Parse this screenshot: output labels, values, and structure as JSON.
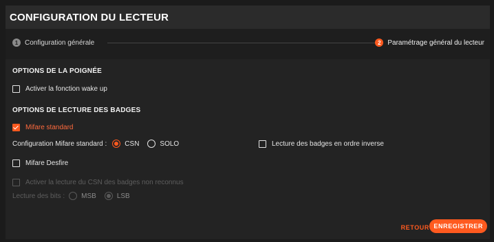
{
  "window": {
    "title": "CONFIGURATION DU LECTEUR"
  },
  "stepper": {
    "steps": [
      {
        "number": "1",
        "label": "Configuration générale"
      },
      {
        "number": "2",
        "label": "Paramétrage général du lecteur"
      }
    ],
    "active_step": 2
  },
  "handle_options": {
    "title": "OPTIONS DE LA POIGNÉE",
    "wake_up_label": "Activer la fonction wake up",
    "wake_up_checked": false
  },
  "badge_options": {
    "title": "OPTIONS DE LECTURE DES BADGES",
    "mifare_standard_label": "Mifare standard",
    "mifare_standard_checked": true,
    "mifare_config_label": "Configuration Mifare standard :",
    "mifare_config_options": [
      "CSN",
      "SOLO"
    ],
    "mifare_config_selected": "CSN",
    "reverse_order_label": "Lecture des badges en ordre inverse",
    "reverse_order_checked": false,
    "mifare_desfire_label": "Mifare Desfire",
    "mifare_desfire_checked": false,
    "unknown_csn_label": "Activer la lecture du CSN des badges non reconnus",
    "unknown_csn_checked": false,
    "bits_label": "Lecture des bits :",
    "bits_options": [
      "MSB",
      "LSB"
    ],
    "bits_selected": "LSB"
  },
  "actions": {
    "back_label": "RETOUR",
    "save_label": "ENREGISTRER"
  },
  "colors": {
    "accent": "#ff5a1f",
    "background": "#232323",
    "header": "#2b2b2b"
  }
}
